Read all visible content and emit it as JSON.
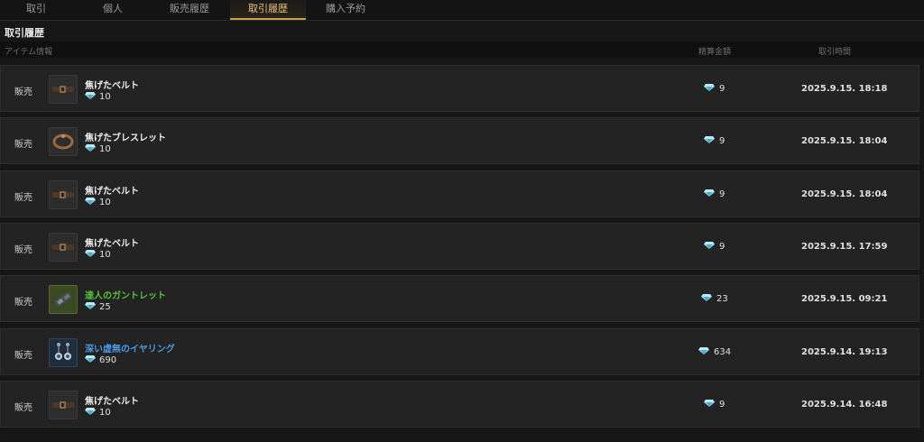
{
  "tabs": [
    {
      "label": "取引",
      "active": false
    },
    {
      "label": "個人",
      "active": false
    },
    {
      "label": "販売履歴",
      "active": false
    },
    {
      "label": "取引履歴",
      "active": true
    },
    {
      "label": "購入予約",
      "active": false
    }
  ],
  "section_title": "取引履歴",
  "columns": {
    "item_info": "アイテム情報",
    "settlement": "精算金額",
    "trade_time": "取引時間"
  },
  "currency_icon": "diamond-gem-icon",
  "colors": {
    "accent": "#c9a25a",
    "rare_green": "#57c03e",
    "rare_blue": "#4a9be8"
  },
  "rows": [
    {
      "type": "販売",
      "name": "焦げたベルト",
      "rarity": "normal",
      "icon": "belt-icon",
      "unit_price": "10",
      "total": "9",
      "time": "2025.9.15. 18:18"
    },
    {
      "type": "販売",
      "name": "焦げたブレスレット",
      "rarity": "normal",
      "icon": "bracelet-icon",
      "unit_price": "10",
      "total": "9",
      "time": "2025.9.15. 18:04"
    },
    {
      "type": "販売",
      "name": "焦げたベルト",
      "rarity": "normal",
      "icon": "belt-icon",
      "unit_price": "10",
      "total": "9",
      "time": "2025.9.15. 18:04"
    },
    {
      "type": "販売",
      "name": "焦げたベルト",
      "rarity": "normal",
      "icon": "belt-icon",
      "unit_price": "10",
      "total": "9",
      "time": "2025.9.15. 17:59"
    },
    {
      "type": "販売",
      "name": "達人のガントレット",
      "rarity": "green",
      "icon": "gauntlet-icon",
      "unit_price": "25",
      "total": "23",
      "time": "2025.9.15. 09:21"
    },
    {
      "type": "販売",
      "name": "深い虚無のイヤリング",
      "rarity": "blue",
      "icon": "earring-icon",
      "unit_price": "690",
      "total": "634",
      "time": "2025.9.14. 19:13"
    },
    {
      "type": "販売",
      "name": "焦げたベルト",
      "rarity": "normal",
      "icon": "belt-icon",
      "unit_price": "10",
      "total": "9",
      "time": "2025.9.14. 16:48"
    }
  ]
}
